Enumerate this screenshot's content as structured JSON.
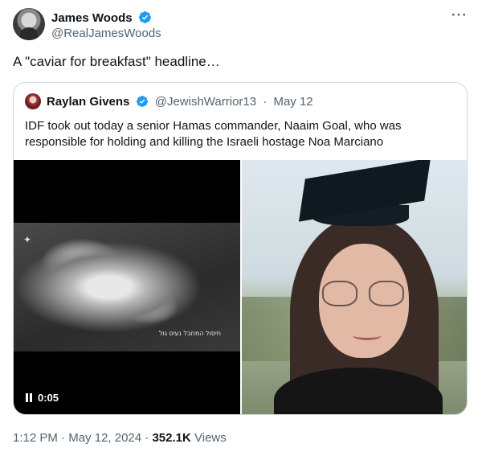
{
  "author": {
    "name": "James Woods",
    "handle": "@RealJamesWoods",
    "verified_color": "#1d9bf0"
  },
  "tweet_text": "A \"caviar for breakfast\" headline…",
  "quoted": {
    "name": "Raylan Givens",
    "handle": "@JewishWarrior13",
    "separator": "·",
    "date": "May 12",
    "text": "IDF took out today a senior Hamas commander, Naaim Goal, who was responsible for holding and killing the Israeli hostage  Noa Marciano",
    "video": {
      "time": "0:05",
      "caption": "חיסול המחבל נעים גול"
    }
  },
  "meta": {
    "time": "1:12 PM",
    "sep1": "·",
    "date": "May 12, 2024",
    "sep2": "·",
    "views_count": "352.1K",
    "views_label": "Views"
  },
  "icons": {
    "more": "more-icon",
    "verified": "verified-badge-icon",
    "pause": "pause-icon"
  }
}
